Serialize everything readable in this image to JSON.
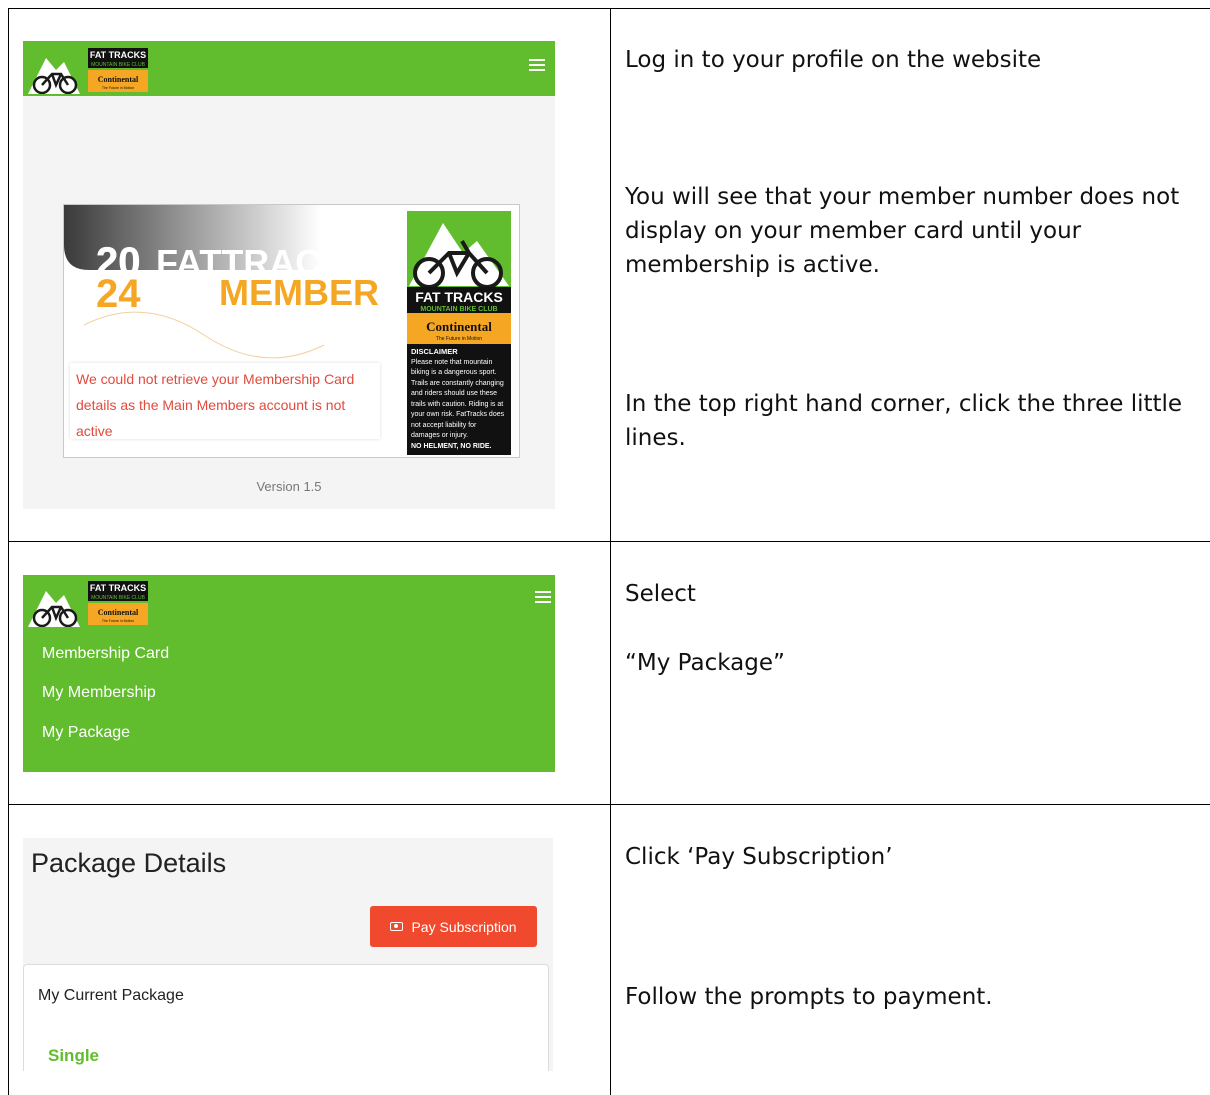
{
  "colors": {
    "brand_green": "#62bd2e",
    "brand_yellow": "#f5a623",
    "error_red": "#e14a3c",
    "button_red": "#f0492e",
    "card_orange": "#f5a623"
  },
  "logo": {
    "line1": "FAT TRACKS",
    "line2": "MOUNTAIN BIKE CLUB",
    "sponsor": "Continental",
    "sponsor_tag": "The Future in Motion"
  },
  "rows": [
    {
      "screenshot": {
        "menu_icon": "hamburger-menu-icon",
        "card": {
          "year_top": "20",
          "year_bottom": "24",
          "brand": "FATTRACKS",
          "member": "MEMBER",
          "error_text": "We could not retrieve your Membership Card details as the Main Members account is not active",
          "disclaimer_title": "DISCLAIMER",
          "disclaimer_body": "Please note that mountain biking is a dangerous sport. Trails are constantly changing and riders should use these trails with caution. Riding is at your own risk. FatTracks does not accept liability for damages or injury.",
          "disclaimer_foot": "NO HELMENT, NO RIDE."
        },
        "version": "Version 1.5"
      },
      "instructions": [
        "Log in to your profile on the website",
        "You will see that your member number does not display on your member card until your membership is active.",
        "In the top right hand corner, click the three little lines."
      ]
    },
    {
      "screenshot": {
        "menu_icon": "hamburger-menu-icon",
        "nav_items": [
          "Membership Card",
          "My Membership",
          "My Package"
        ]
      },
      "instructions": [
        "Select",
        "“My Package”"
      ]
    },
    {
      "screenshot": {
        "title": "Package Details",
        "pay_button": "Pay Subscription",
        "pay_icon": "cash-icon",
        "card_title": "My Current Package",
        "package_name": "Single"
      },
      "instructions": [
        "Click ‘Pay Subscription’",
        "Follow the prompts to payment."
      ]
    }
  ]
}
